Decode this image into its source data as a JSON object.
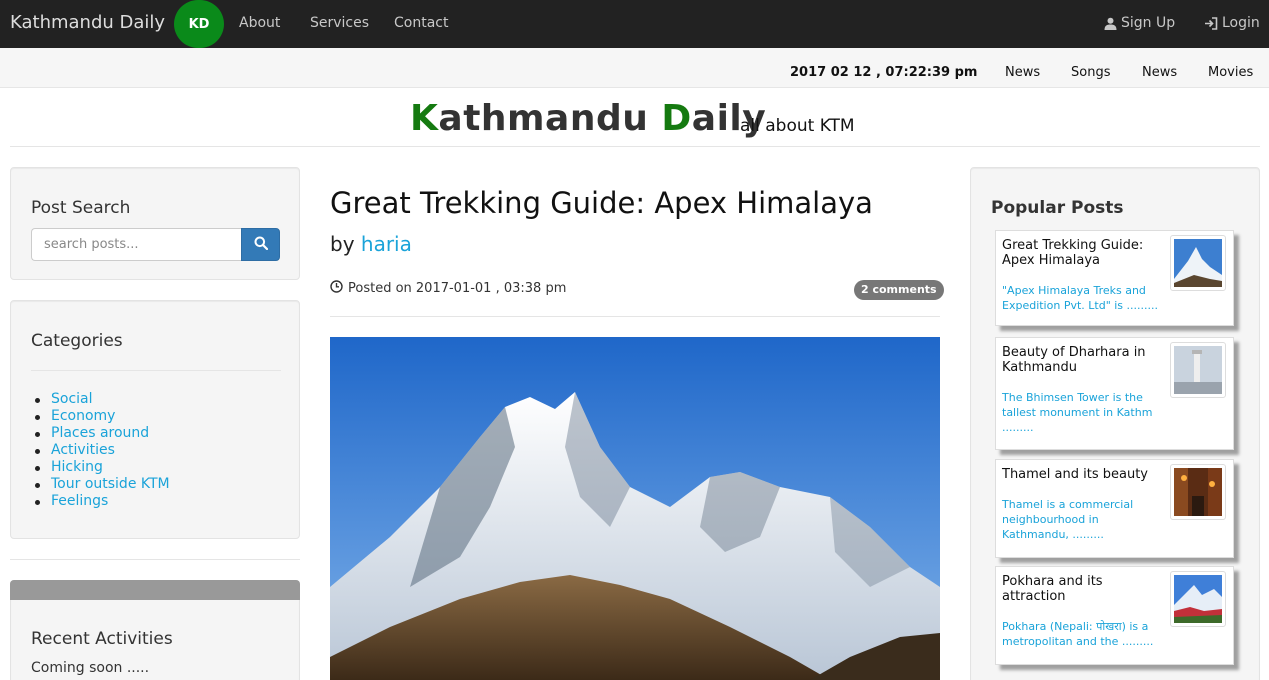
{
  "navbar": {
    "brand": "Kathmandu Daily",
    "badge": "KD",
    "links": [
      "About",
      "Services",
      "Contact"
    ],
    "signup": "Sign Up",
    "login": "Login"
  },
  "subbar": {
    "datetime": "2017 02 12 , 07:22:39 pm",
    "links": [
      "News",
      "Songs",
      "News",
      "Movies"
    ]
  },
  "masthead": {
    "title_k": "K",
    "title_part1": "athmandu ",
    "title_d": "D",
    "title_part2": "aily",
    "tagline": "all about KTM"
  },
  "search": {
    "heading": "Post Search",
    "placeholder": "search posts..."
  },
  "categories": {
    "heading": "Categories",
    "items": [
      "Social",
      "Economy",
      "Places around",
      "Activities",
      "Hicking",
      "Tour outside KTM",
      "Feelings"
    ]
  },
  "recent": {
    "heading": "Recent Activities",
    "text": "Coming soon ....."
  },
  "post": {
    "title": "Great Trekking Guide: Apex Himalaya",
    "by": "by",
    "author": "haria",
    "posted_on": "Posted on 2017-01-01 , 03:38 pm",
    "comments": "2 comments"
  },
  "popular": {
    "heading": "Popular Posts",
    "items": [
      {
        "title": "Great Trekking Guide: Apex Himalaya",
        "excerpt": "\"Apex Himalaya Treks and Expedition Pvt. Ltd\" is ........."
      },
      {
        "title": "Beauty of Dharhara in Kathmandu",
        "excerpt": "The Bhimsen Tower is the tallest monument in Kathm ........."
      },
      {
        "title": "Thamel and its beauty",
        "excerpt": "Thamel is a commercial neighbourhood in Kathmandu, ........."
      },
      {
        "title": "Pokhara and its attraction",
        "excerpt": "Pokhara (Nepali: पोखरा) is a metropolitan and the ........."
      }
    ]
  },
  "colors": {
    "navbar_bg": "#222222",
    "brand_green": "#0a8a1a",
    "link_blue": "#1aa3d9",
    "search_btn": "#337ab7",
    "badge_gray": "#777777"
  },
  "icons": {
    "signup": "user-icon",
    "login": "login-icon",
    "search": "search-icon",
    "clock": "clock-icon"
  }
}
